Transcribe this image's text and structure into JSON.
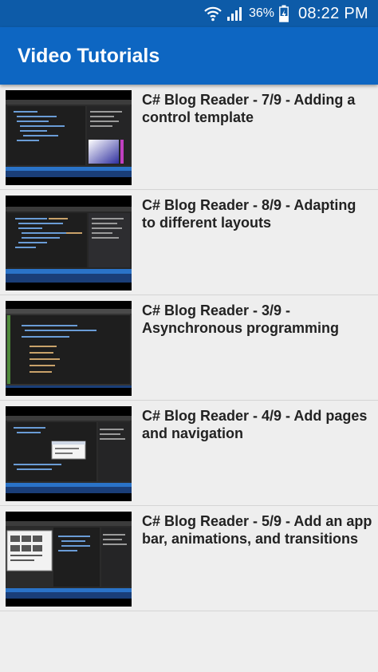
{
  "status_bar": {
    "battery_percent": "36%",
    "time": "08:22 PM",
    "icons": [
      "wifi-icon",
      "signal-icon",
      "battery-charging-icon"
    ]
  },
  "app_bar": {
    "title": "Video Tutorials",
    "background_color": "#0d66c2"
  },
  "videos": [
    {
      "title": "C# Blog Reader - 7/9 - Adding a control template",
      "thumbnail": "visual-studio-screenshot"
    },
    {
      "title": "C# Blog Reader - 8/9 - Adapting to different layouts",
      "thumbnail": "visual-studio-screenshot"
    },
    {
      "title": "C# Blog Reader - 3/9 - Asynchronous programming",
      "thumbnail": "visual-studio-screenshot"
    },
    {
      "title": "C# Blog Reader - 4/9 - Add pages and navigation",
      "thumbnail": "visual-studio-screenshot"
    },
    {
      "title": "C# Blog Reader - 5/9 - Add an app bar, animations, and transitions",
      "thumbnail": "visual-studio-screenshot"
    }
  ]
}
